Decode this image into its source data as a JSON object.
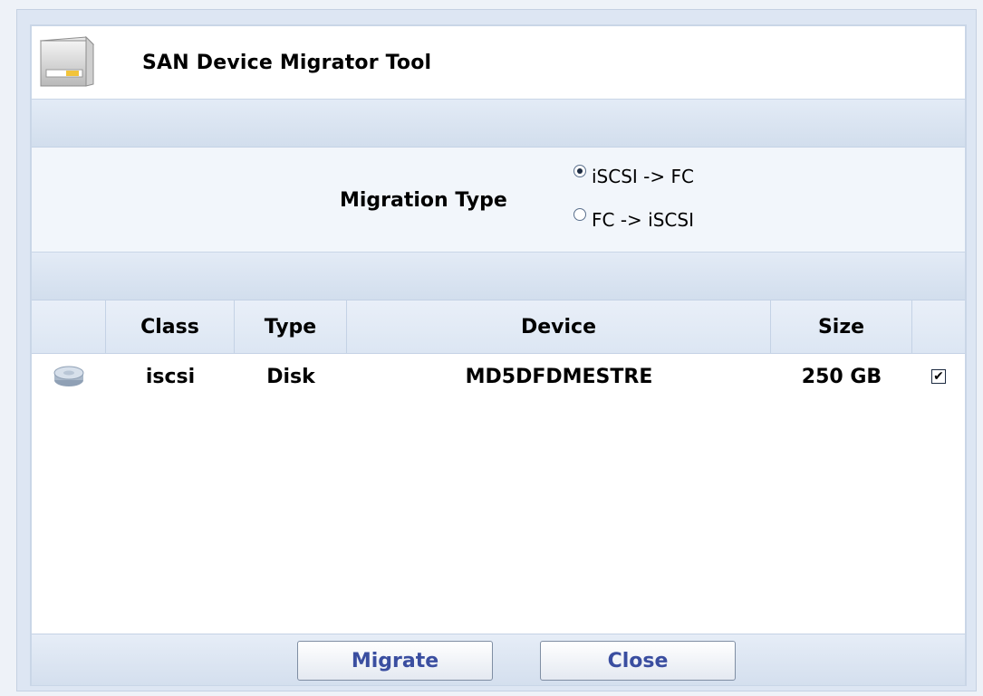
{
  "title": "SAN Device Migrator Tool",
  "migration": {
    "label": "Migration Type",
    "options": [
      "iSCSI -> FC",
      "FC -> iSCSI"
    ],
    "selected": "iSCSI -> FC"
  },
  "table": {
    "columns": [
      "",
      "Class",
      "Type",
      "Device",
      "Size",
      ""
    ],
    "rows": [
      {
        "icon": "disk-icon",
        "class": "iscsi",
        "type": "Disk",
        "device": "MD5DFDMESTRE",
        "size": "250 GB",
        "checked": true
      }
    ]
  },
  "buttons": {
    "migrate": "Migrate",
    "close": "Close"
  },
  "colors": {
    "accent_text": "#3a4ea0",
    "bar": "#dce6f3"
  }
}
